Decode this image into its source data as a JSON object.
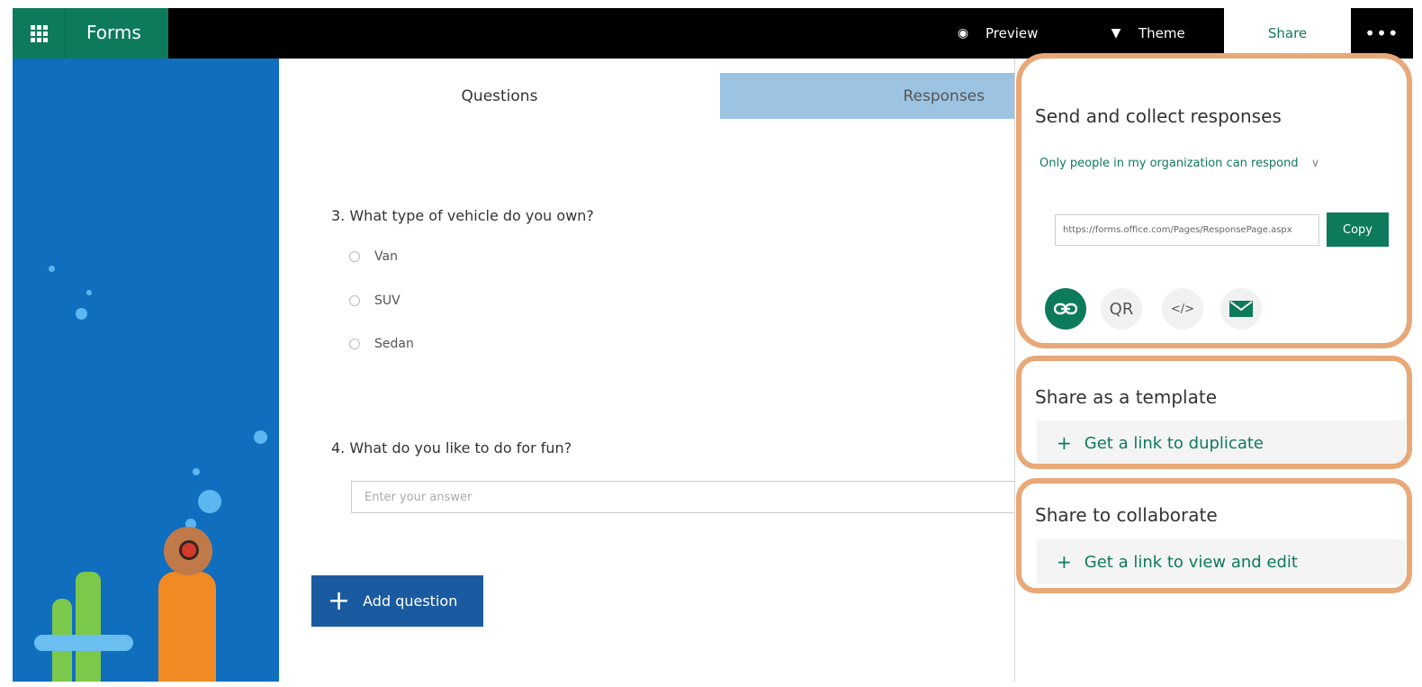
{
  "app": {
    "name": "Forms"
  },
  "topbar": {
    "preview_label": "Preview",
    "theme_label": "Theme",
    "share_label": "Share",
    "more_label": "•••"
  },
  "tabs": {
    "questions": "Questions",
    "responses": "Responses"
  },
  "questions": [
    {
      "title": "3. What type of vehicle do you own?",
      "options": [
        "Van",
        "SUV",
        "Sedan"
      ]
    },
    {
      "title": "4. What do you like to do for fun?",
      "placeholder": "Enter your answer"
    }
  ],
  "add_question_label": "Add question",
  "share": {
    "send_heading": "Send and collect responses",
    "permission": "Only people in my organization can respond",
    "url": "https://forms.office.com/Pages/ResponsePage.aspx",
    "copy_label": "Copy",
    "icons": [
      {
        "name": "link-icon"
      },
      {
        "name": "qr-icon",
        "label": "QR"
      },
      {
        "name": "embed-icon",
        "label": "</>"
      },
      {
        "name": "email-icon"
      }
    ],
    "template_heading": "Share as a template",
    "template_link": "Get a link to duplicate",
    "collab_heading": "Share to collaborate",
    "collab_link": "Get a link to view and edit"
  },
  "colors": {
    "brand": "#0e7a5c",
    "blue_panel": "#0f6fbe",
    "highlight_ring": "#e8a878",
    "responses_tab": "#9dc3e2"
  }
}
